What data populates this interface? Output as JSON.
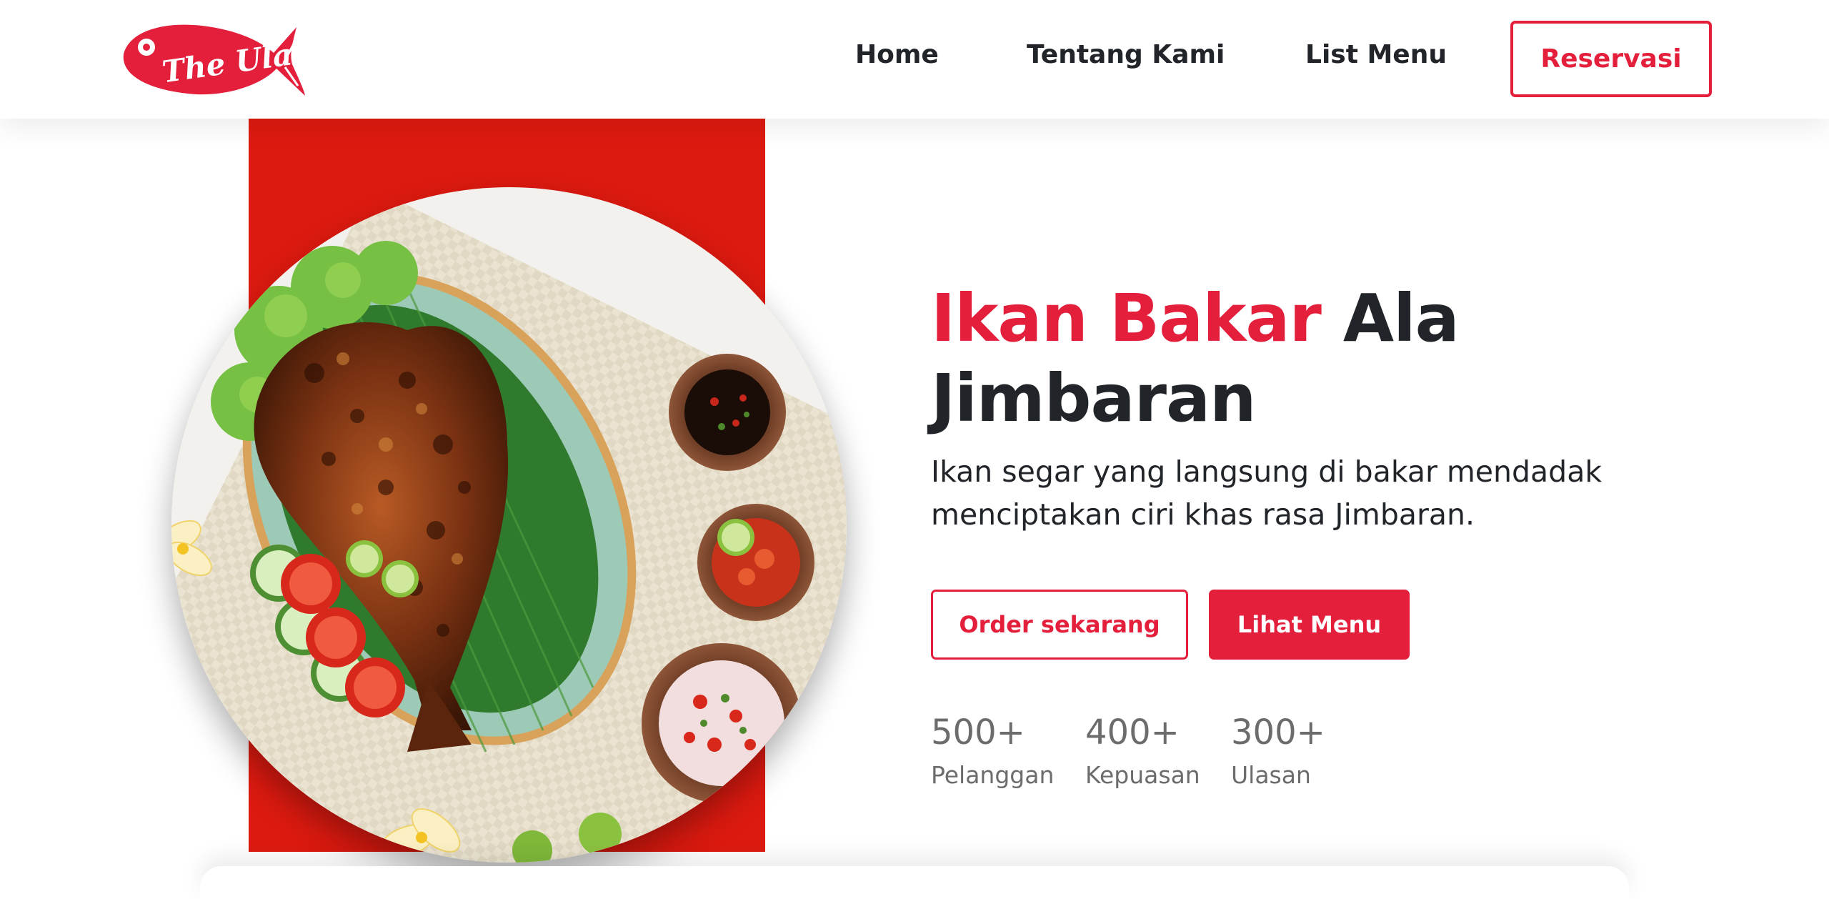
{
  "brand": {
    "logo_text": "The Ulam",
    "logo_color": "#e31f3c",
    "logo_icon": "fish-logo"
  },
  "nav": {
    "home": "Home",
    "about": "Tentang Kami",
    "menu": "List Menu",
    "reservation": "Reservasi"
  },
  "hero": {
    "title_accent": "Ikan Bakar",
    "title_rest_1": "Ala",
    "title_rest_2": "Jimbaran",
    "description": "Ikan segar yang langsung di bakar mendadak menciptakan ciri khas rasa Jimbaran.",
    "order_button": "Order sekarang",
    "menu_button": "Lihat Menu",
    "image_alt": "grilled-fish-plate-image"
  },
  "stats": [
    {
      "value": "500+",
      "label": "Pelanggan"
    },
    {
      "value": "400+",
      "label": "Kepuasan"
    },
    {
      "value": "300+",
      "label": "Ulasan"
    }
  ],
  "colors": {
    "accent": "#e31f3c",
    "hero_block": "#dd1a10",
    "text_dark": "#212529",
    "text_muted": "#6c6c6c"
  }
}
